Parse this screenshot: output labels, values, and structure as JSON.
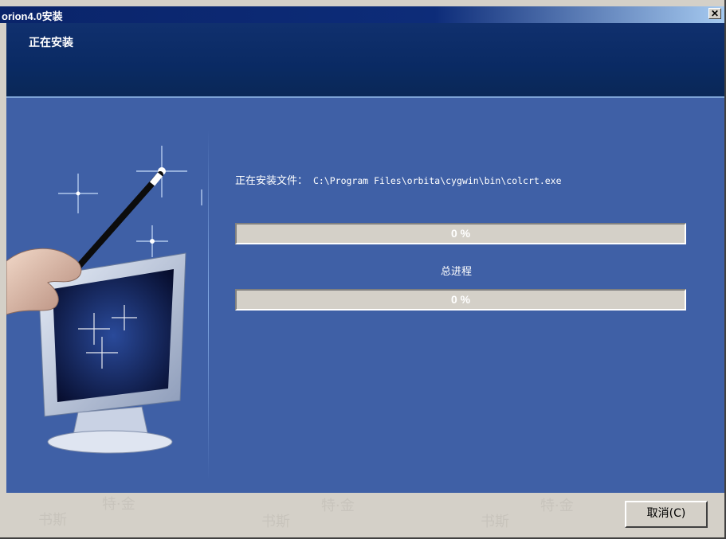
{
  "window": {
    "title": "orion4.0安装",
    "close_label": "✕"
  },
  "header": {
    "heading": "正在安装"
  },
  "install": {
    "file_label": "正在安装文件：",
    "file_path": "C:\\Program Files\\orbita\\cygwin\\bin\\colcrt.exe",
    "file_progress": {
      "value": 0,
      "label": "0 %"
    },
    "overall_label": "总进程",
    "overall_progress": {
      "value": 0,
      "label": "0 %"
    }
  },
  "footer": {
    "cancel_label": "取消(C)",
    "watermark_text": [
      "书斯",
      "特·金"
    ]
  },
  "icons": {
    "close": "close-icon",
    "illustration": "magic-wand-monitor-illustration"
  },
  "colors": {
    "title_bar": "#0a246a",
    "header": "#10306e",
    "content": "#3f60a6",
    "progress_bg": "#d4d0c8"
  }
}
